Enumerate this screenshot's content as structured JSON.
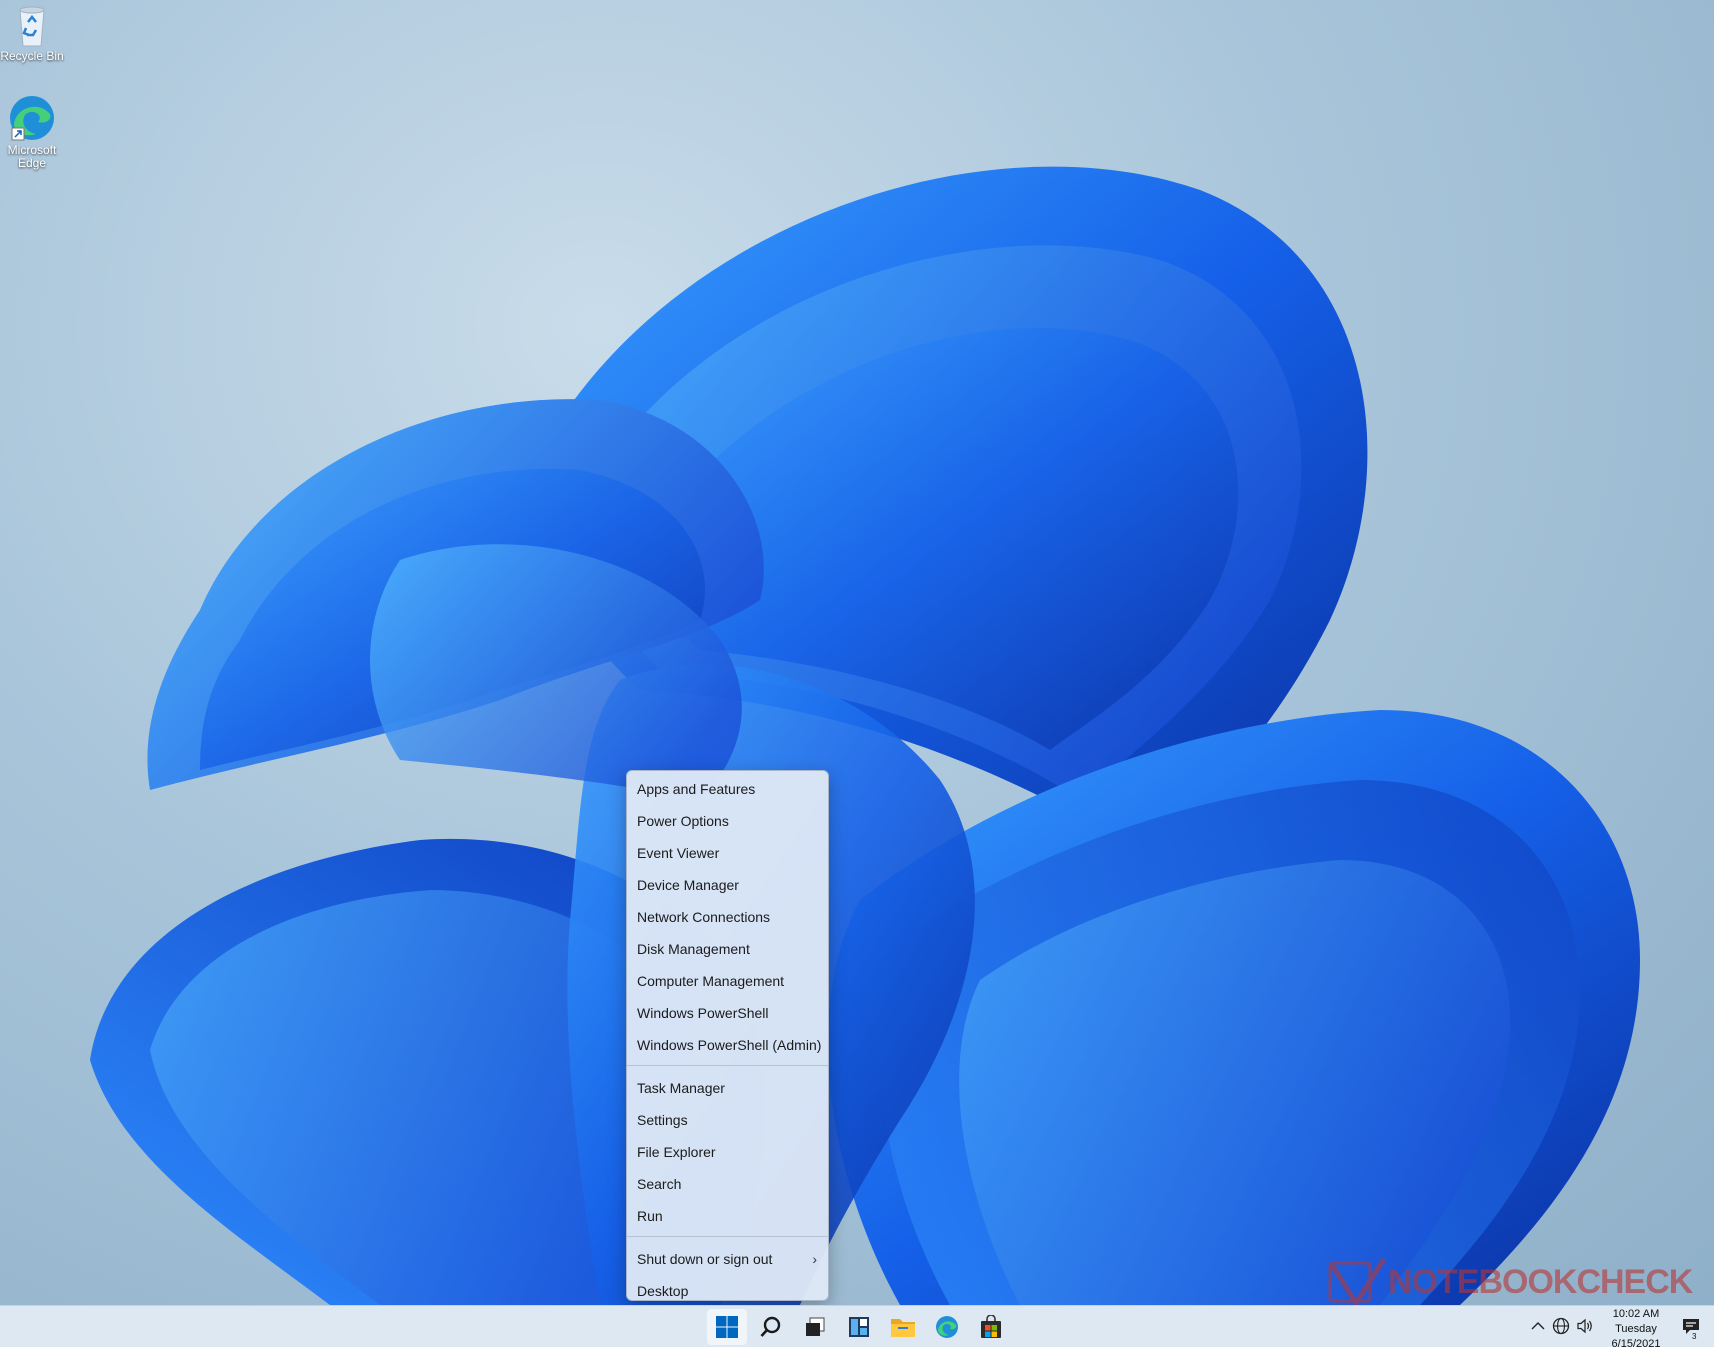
{
  "desktop": {
    "icons": [
      {
        "label": "Recycle Bin",
        "icon": "recycle-bin-icon"
      },
      {
        "label": "Microsoft Edge",
        "icon": "edge-icon"
      }
    ]
  },
  "context_menu": {
    "group1": [
      {
        "label": "Apps and Features"
      },
      {
        "label": "Power Options"
      },
      {
        "label": "Event Viewer"
      },
      {
        "label": "Device Manager"
      },
      {
        "label": "Network Connections"
      },
      {
        "label": "Disk Management"
      },
      {
        "label": "Computer Management"
      },
      {
        "label": "Windows PowerShell"
      },
      {
        "label": "Windows PowerShell (Admin)"
      }
    ],
    "group2": [
      {
        "label": "Task Manager"
      },
      {
        "label": "Settings"
      },
      {
        "label": "File Explorer"
      },
      {
        "label": "Search"
      },
      {
        "label": "Run"
      }
    ],
    "group3": [
      {
        "label": "Shut down or sign out",
        "submenu_arrow": "›"
      },
      {
        "label": "Desktop"
      }
    ]
  },
  "taskbar": {
    "apps": [
      "start-icon",
      "search-icon",
      "task-view-icon",
      "widgets-icon",
      "file-explorer-icon",
      "edge-icon",
      "store-icon"
    ],
    "tray": {
      "chevron": "^",
      "time": "10:02 AM",
      "day": "Tuesday",
      "date": "6/15/2021",
      "notification_count": "3"
    }
  },
  "watermark": {
    "text": "NOTEBOOKCHECK"
  },
  "colors": {
    "accent": "#0067c0",
    "taskbar": "#dde8f2",
    "menu": "#dee8f6"
  }
}
